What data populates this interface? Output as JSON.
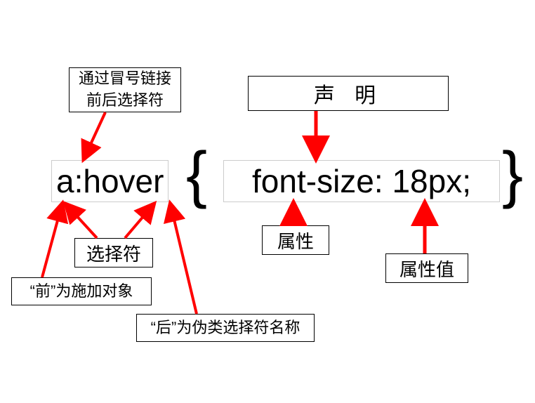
{
  "annotations": {
    "colon_link": "通过冒号链接前后选择符",
    "declaration": "声 明",
    "selector": "选择符",
    "property": "属性",
    "value": "属性值",
    "front_target": "“前”为施加对象",
    "back_pseudo": "“后”为伪类选择符名称"
  },
  "code": {
    "selector_text": "a:hover",
    "open_brace": "{",
    "declaration_text": "font-size: 18px;",
    "close_brace": "}"
  }
}
